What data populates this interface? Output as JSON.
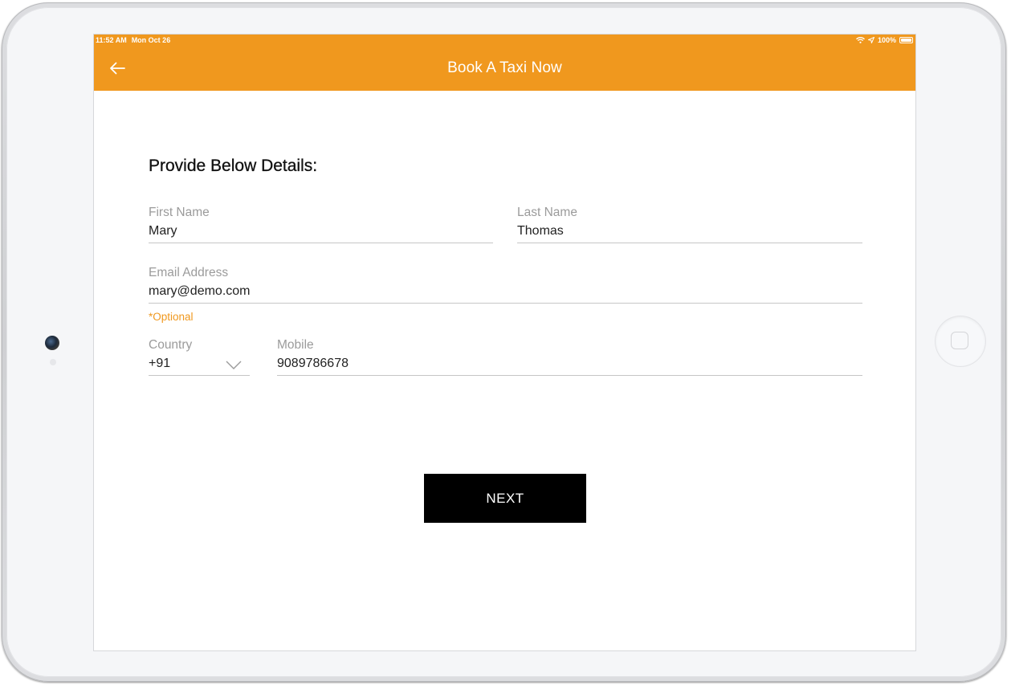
{
  "status_bar": {
    "time": "11:52 AM",
    "date": "Mon Oct 26",
    "battery": "100%",
    "icons": [
      "wifi-icon",
      "location-icon",
      "battery-icon"
    ]
  },
  "nav": {
    "title": "Book A Taxi Now",
    "back_icon": "arrow-left-icon"
  },
  "form": {
    "heading": "Provide Below Details:",
    "first_name": {
      "label": "First Name",
      "value": "Mary"
    },
    "last_name": {
      "label": "Last Name",
      "value": "Thomas"
    },
    "email": {
      "label": "Email Address",
      "value": "mary@demo.com",
      "note": "*Optional"
    },
    "country": {
      "label": "Country",
      "value": "+91",
      "icon": "chevron-down-icon"
    },
    "mobile": {
      "label": "Mobile",
      "value": "9089786678"
    }
  },
  "next_label": "NEXT",
  "colors": {
    "accent": "#f0981e",
    "button": "#000000",
    "label": "#9b9b9b",
    "underline": "#c6c6c6"
  }
}
